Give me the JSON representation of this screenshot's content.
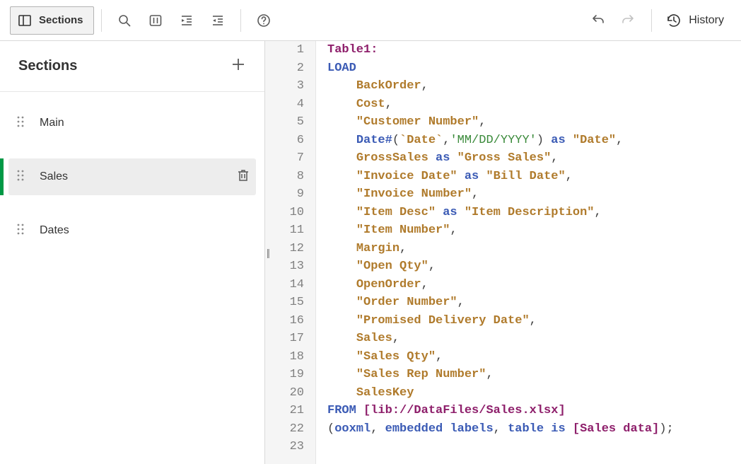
{
  "toolbar": {
    "sections_label": "Sections",
    "history_label": "History"
  },
  "sidebar": {
    "title": "Sections",
    "items": [
      {
        "label": "Main",
        "active": false
      },
      {
        "label": "Sales",
        "active": true
      },
      {
        "label": "Dates",
        "active": false
      }
    ]
  },
  "editor": {
    "line_count": 23,
    "lines": [
      [
        {
          "cls": "tk-tabledef",
          "text": "Table1:"
        }
      ],
      [
        {
          "cls": "tk-keyword",
          "text": "LOAD"
        }
      ],
      [
        {
          "cls": "tk-plain",
          "text": "    "
        },
        {
          "cls": "tk-field",
          "text": "BackOrder"
        },
        {
          "cls": "tk-plain",
          "text": ","
        }
      ],
      [
        {
          "cls": "tk-plain",
          "text": "    "
        },
        {
          "cls": "tk-field",
          "text": "Cost"
        },
        {
          "cls": "tk-plain",
          "text": ","
        }
      ],
      [
        {
          "cls": "tk-plain",
          "text": "    "
        },
        {
          "cls": "tk-field",
          "text": "\"Customer Number\""
        },
        {
          "cls": "tk-plain",
          "text": ","
        }
      ],
      [
        {
          "cls": "tk-plain",
          "text": "    "
        },
        {
          "cls": "tk-func",
          "text": "Date#"
        },
        {
          "cls": "tk-plain",
          "text": "("
        },
        {
          "cls": "tk-field",
          "text": "`Date`"
        },
        {
          "cls": "tk-plain",
          "text": ","
        },
        {
          "cls": "tk-string",
          "text": "'MM/DD/YYYY'"
        },
        {
          "cls": "tk-plain",
          "text": ") "
        },
        {
          "cls": "tk-keyword",
          "text": "as"
        },
        {
          "cls": "tk-plain",
          "text": " "
        },
        {
          "cls": "tk-field",
          "text": "\"Date\""
        },
        {
          "cls": "tk-plain",
          "text": ","
        }
      ],
      [
        {
          "cls": "tk-plain",
          "text": "    "
        },
        {
          "cls": "tk-field",
          "text": "GrossSales"
        },
        {
          "cls": "tk-plain",
          "text": " "
        },
        {
          "cls": "tk-keyword",
          "text": "as"
        },
        {
          "cls": "tk-plain",
          "text": " "
        },
        {
          "cls": "tk-field",
          "text": "\"Gross Sales\""
        },
        {
          "cls": "tk-plain",
          "text": ","
        }
      ],
      [
        {
          "cls": "tk-plain",
          "text": "    "
        },
        {
          "cls": "tk-field",
          "text": "\"Invoice Date\""
        },
        {
          "cls": "tk-plain",
          "text": " "
        },
        {
          "cls": "tk-keyword",
          "text": "as"
        },
        {
          "cls": "tk-plain",
          "text": " "
        },
        {
          "cls": "tk-field",
          "text": "\"Bill Date\""
        },
        {
          "cls": "tk-plain",
          "text": ","
        }
      ],
      [
        {
          "cls": "tk-plain",
          "text": "    "
        },
        {
          "cls": "tk-field",
          "text": "\"Invoice Number\""
        },
        {
          "cls": "tk-plain",
          "text": ","
        }
      ],
      [
        {
          "cls": "tk-plain",
          "text": "    "
        },
        {
          "cls": "tk-field",
          "text": "\"Item Desc\""
        },
        {
          "cls": "tk-plain",
          "text": " "
        },
        {
          "cls": "tk-keyword",
          "text": "as"
        },
        {
          "cls": "tk-plain",
          "text": " "
        },
        {
          "cls": "tk-field",
          "text": "\"Item Description\""
        },
        {
          "cls": "tk-plain",
          "text": ","
        }
      ],
      [
        {
          "cls": "tk-plain",
          "text": "    "
        },
        {
          "cls": "tk-field",
          "text": "\"Item Number\""
        },
        {
          "cls": "tk-plain",
          "text": ","
        }
      ],
      [
        {
          "cls": "tk-plain",
          "text": "    "
        },
        {
          "cls": "tk-field",
          "text": "Margin"
        },
        {
          "cls": "tk-plain",
          "text": ","
        }
      ],
      [
        {
          "cls": "tk-plain",
          "text": "    "
        },
        {
          "cls": "tk-field",
          "text": "\"Open Qty\""
        },
        {
          "cls": "tk-plain",
          "text": ","
        }
      ],
      [
        {
          "cls": "tk-plain",
          "text": "    "
        },
        {
          "cls": "tk-field",
          "text": "OpenOrder"
        },
        {
          "cls": "tk-plain",
          "text": ","
        }
      ],
      [
        {
          "cls": "tk-plain",
          "text": "    "
        },
        {
          "cls": "tk-field",
          "text": "\"Order Number\""
        },
        {
          "cls": "tk-plain",
          "text": ","
        }
      ],
      [
        {
          "cls": "tk-plain",
          "text": "    "
        },
        {
          "cls": "tk-field",
          "text": "\"Promised Delivery Date\""
        },
        {
          "cls": "tk-plain",
          "text": ","
        }
      ],
      [
        {
          "cls": "tk-plain",
          "text": "    "
        },
        {
          "cls": "tk-field",
          "text": "Sales"
        },
        {
          "cls": "tk-plain",
          "text": ","
        }
      ],
      [
        {
          "cls": "tk-plain",
          "text": "    "
        },
        {
          "cls": "tk-field",
          "text": "\"Sales Qty\""
        },
        {
          "cls": "tk-plain",
          "text": ","
        }
      ],
      [
        {
          "cls": "tk-plain",
          "text": "    "
        },
        {
          "cls": "tk-field",
          "text": "\"Sales Rep Number\""
        },
        {
          "cls": "tk-plain",
          "text": ","
        }
      ],
      [
        {
          "cls": "tk-plain",
          "text": "    "
        },
        {
          "cls": "tk-field",
          "text": "SalesKey"
        }
      ],
      [
        {
          "cls": "tk-keyword",
          "text": "FROM"
        },
        {
          "cls": "tk-plain",
          "text": " "
        },
        {
          "cls": "tk-bracket",
          "text": "[lib://DataFiles/Sales.xlsx]"
        }
      ],
      [
        {
          "cls": "tk-plain",
          "text": "("
        },
        {
          "cls": "tk-keyword",
          "text": "ooxml"
        },
        {
          "cls": "tk-plain",
          "text": ", "
        },
        {
          "cls": "tk-keyword",
          "text": "embedded labels"
        },
        {
          "cls": "tk-plain",
          "text": ", "
        },
        {
          "cls": "tk-keyword",
          "text": "table is"
        },
        {
          "cls": "tk-plain",
          "text": " "
        },
        {
          "cls": "tk-bracket",
          "text": "[Sales data]"
        },
        {
          "cls": "tk-plain",
          "text": ");"
        }
      ],
      []
    ]
  }
}
